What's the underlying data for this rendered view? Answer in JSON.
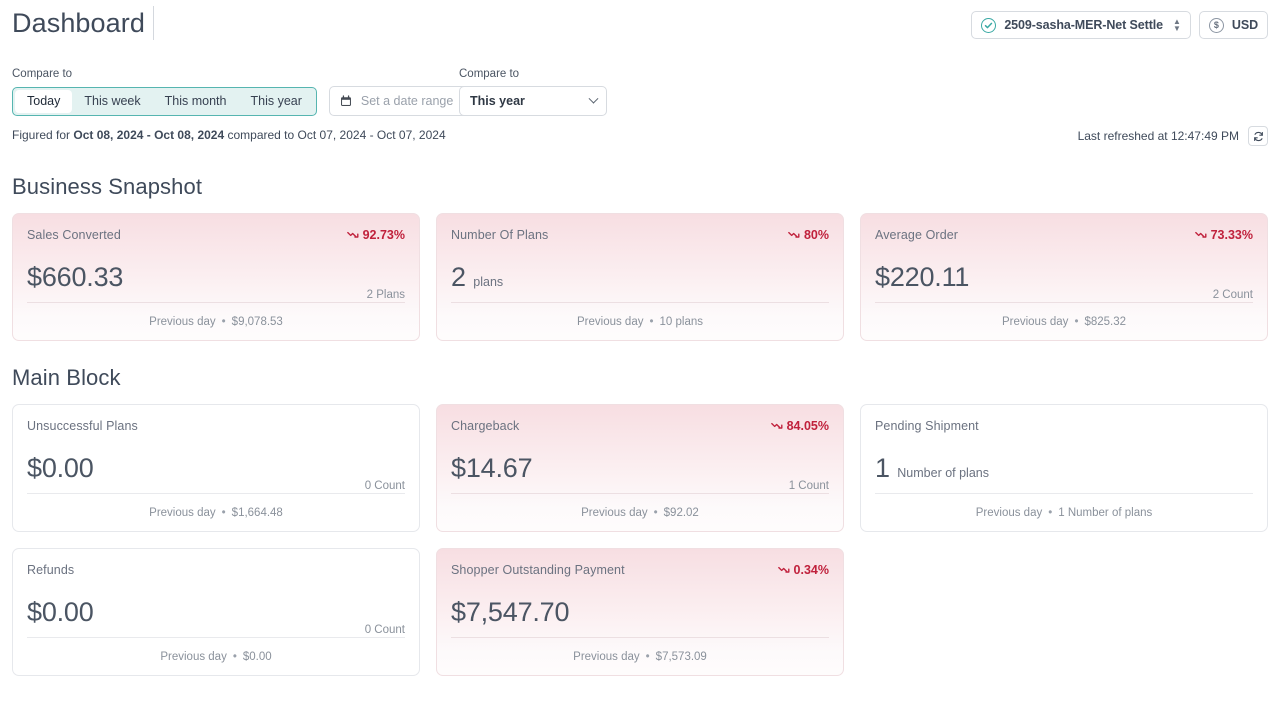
{
  "header": {
    "title": "Dashboard",
    "account": {
      "label": "2509-sasha-MER-Net Settle",
      "icon": "check-circle-icon"
    },
    "currency": {
      "label": "USD",
      "icon": "dollar-circle-icon"
    }
  },
  "filters": {
    "left_label": "Compare to",
    "right_label": "Compare to",
    "segments": [
      "Today",
      "This week",
      "This month",
      "This year"
    ],
    "active_segment": "Today",
    "date_range_placeholder": "Set a date range",
    "date_range_value": "",
    "compare_select_value": "This year"
  },
  "figured": {
    "prefix": "Figured for",
    "primary_range": "Oct 08, 2024 - Oct 08, 2024",
    "middle": "compared to",
    "secondary_range": "Oct 07, 2024 - Oct 07, 2024",
    "last_refreshed": "Last refreshed at 12:47:49 PM",
    "refresh_icon": "refresh-icon"
  },
  "sections": [
    {
      "title": "Business Snapshot",
      "cards": [
        {
          "title": "Sales Converted",
          "value": "$660.33",
          "unit_inline": "",
          "unit_right": "2 Plans",
          "trend": "92.73%",
          "trend_direction": "down",
          "alert": true,
          "footer_label": "Previous day",
          "footer_value": "$9,078.53"
        },
        {
          "title": "Number Of Plans",
          "value": "2",
          "unit_inline": "plans",
          "unit_right": "",
          "trend": "80%",
          "trend_direction": "down",
          "alert": true,
          "footer_label": "Previous day",
          "footer_value": "10 plans"
        },
        {
          "title": "Average Order",
          "value": "$220.11",
          "unit_inline": "",
          "unit_right": "2 Count",
          "trend": "73.33%",
          "trend_direction": "down",
          "alert": true,
          "footer_label": "Previous day",
          "footer_value": "$825.32"
        }
      ]
    },
    {
      "title": "Main Block",
      "cards": [
        {
          "title": "Unsuccessful Plans",
          "value": "$0.00",
          "unit_inline": "",
          "unit_right": "0 Count",
          "trend": "",
          "trend_direction": "",
          "alert": false,
          "footer_label": "Previous day",
          "footer_value": "$1,664.48"
        },
        {
          "title": "Chargeback",
          "value": "$14.67",
          "unit_inline": "",
          "unit_right": "1 Count",
          "trend": "84.05%",
          "trend_direction": "down",
          "alert": true,
          "footer_label": "Previous day",
          "footer_value": "$92.02"
        },
        {
          "title": "Pending Shipment",
          "value": "1",
          "unit_inline": "Number of plans",
          "unit_right": "",
          "trend": "",
          "trend_direction": "",
          "alert": false,
          "footer_label": "Previous day",
          "footer_value": "1 Number of plans"
        },
        {
          "title": "Refunds",
          "value": "$0.00",
          "unit_inline": "",
          "unit_right": "0 Count",
          "trend": "",
          "trend_direction": "",
          "alert": false,
          "footer_label": "Previous day",
          "footer_value": "$0.00"
        },
        {
          "title": "Shopper Outstanding Payment",
          "value": "$7,547.70",
          "unit_inline": "",
          "unit_right": "",
          "trend": "0.34%",
          "trend_direction": "down",
          "alert": true,
          "footer_label": "Previous day",
          "footer_value": "$7,573.09"
        }
      ]
    }
  ],
  "colors": {
    "accent_teal": "#56b5b0",
    "alert_pink": "#f7dee2",
    "trend_down": "#c0213c",
    "heading": "#3f4a5a"
  }
}
